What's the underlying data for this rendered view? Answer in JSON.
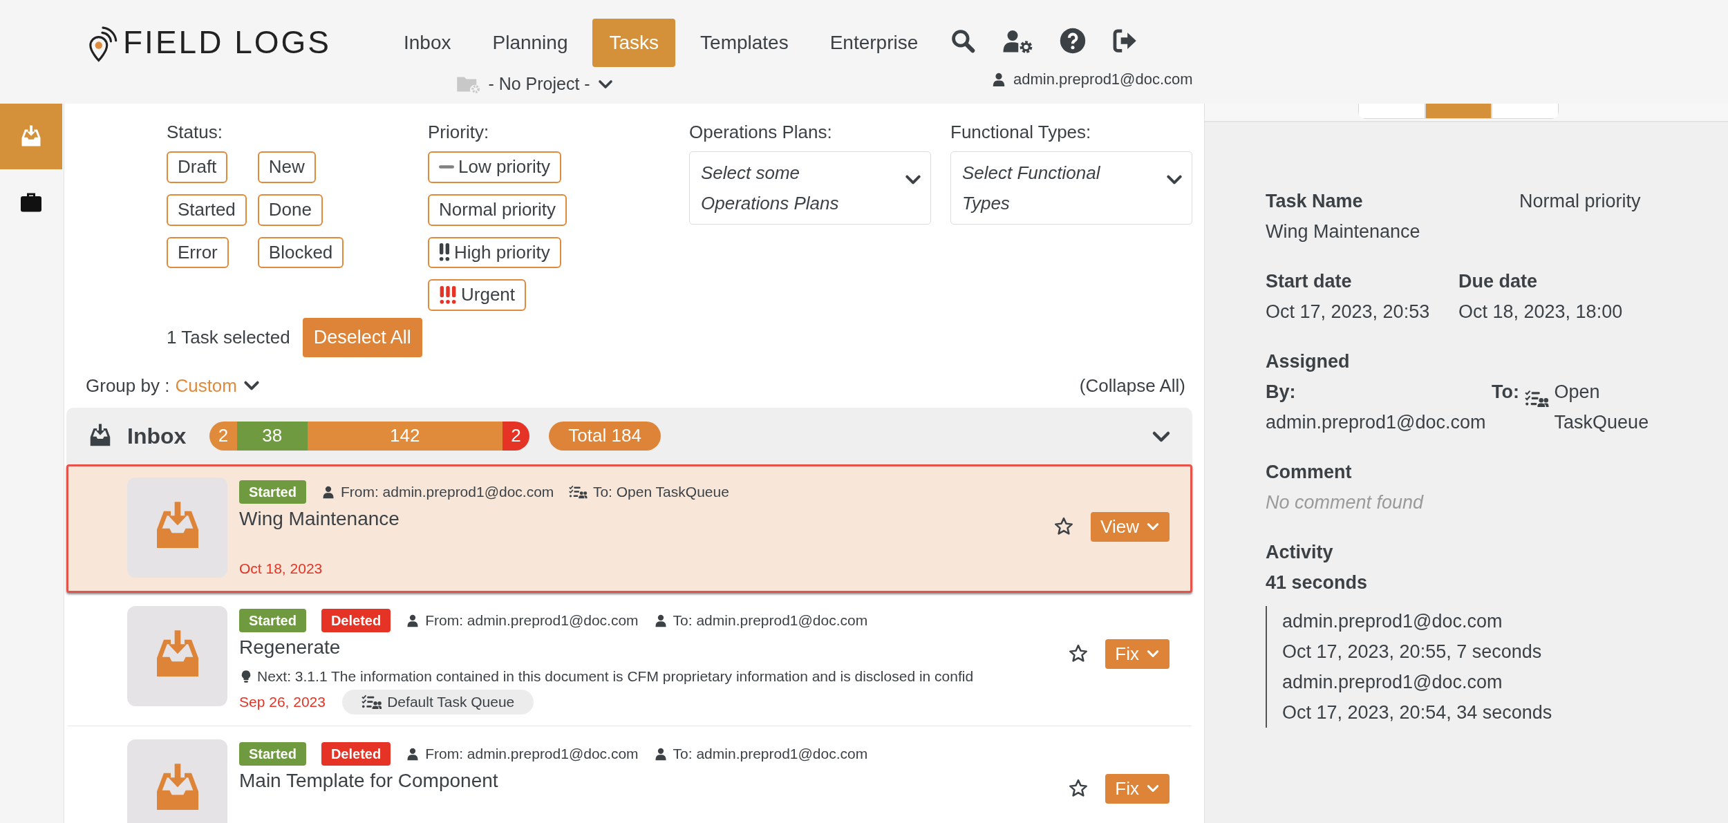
{
  "header": {
    "logo": "FIELD LOGS",
    "nav": [
      {
        "label": "Inbox",
        "selected": false
      },
      {
        "label": "Planning",
        "selected": false
      },
      {
        "label": "Tasks",
        "selected": true
      },
      {
        "label": "Templates",
        "selected": false
      },
      {
        "label": "Enterprise",
        "selected": false
      }
    ],
    "project": "- No Project -",
    "user": "admin.preprod1@doc.com"
  },
  "sidebar": {
    "items": [
      {
        "kind": "inbox",
        "selected": true
      },
      {
        "kind": "briefcase",
        "selected": false
      }
    ]
  },
  "filters": {
    "status": {
      "label": "Status:",
      "options": [
        "Draft",
        "New",
        "Started",
        "Done",
        "Error",
        "Blocked"
      ]
    },
    "priority": {
      "label": "Priority:",
      "options": [
        {
          "kind": "low",
          "label": "Low priority"
        },
        {
          "kind": "normal",
          "label": "Normal priority"
        },
        {
          "kind": "high",
          "label": "High priority"
        },
        {
          "kind": "urgent",
          "label": "Urgent"
        }
      ]
    },
    "operations_plans": {
      "label": "Operations Plans:",
      "placeholder": "Select some Operations Plans"
    },
    "functional_types": {
      "label": "Functional Types:",
      "placeholder": "Select Functional Types"
    }
  },
  "selection": {
    "text": "1 Task selected",
    "button": "Deselect All"
  },
  "group_by": {
    "label": "Group by :",
    "value": "Custom"
  },
  "collapse_all": "(Collapse All)",
  "group": {
    "title": "Inbox",
    "expanded": true,
    "total": "Total 184",
    "segments": [
      {
        "label": "2",
        "color": "#e08a3c"
      },
      {
        "label": "38",
        "color": "#6f9a3f"
      },
      {
        "label": "142",
        "color": "#e08a3c"
      },
      {
        "label": "2",
        "color": "#e53325"
      }
    ]
  },
  "tasks": [
    {
      "selected": true,
      "starred": false,
      "badges": [
        {
          "kind": "started",
          "label": "Started"
        }
      ],
      "from": "From: admin.preprod1@doc.com",
      "to": {
        "kind": "queue",
        "text": "To: Open TaskQueue"
      },
      "title": "Wing Maintenance",
      "date": "Oct 18, 2023",
      "action": "View"
    },
    {
      "selected": false,
      "starred": false,
      "badges": [
        {
          "kind": "started",
          "label": "Started"
        },
        {
          "kind": "deleted",
          "label": "Deleted"
        }
      ],
      "from": "From: admin.preprod1@doc.com",
      "to": {
        "kind": "user",
        "text": "To: admin.preprod1@doc.com"
      },
      "title": "Regenerate",
      "next": "Next: 3.1.1 The information contained in this document is CFM proprietary information and is disclosed in confid",
      "date": "Sep 26, 2023",
      "queue": "Default Task Queue",
      "action": "Fix"
    },
    {
      "selected": false,
      "starred": false,
      "badges": [
        {
          "kind": "started",
          "label": "Started"
        },
        {
          "kind": "deleted",
          "label": "Deleted"
        }
      ],
      "from": "From: admin.preprod1@doc.com",
      "to": {
        "kind": "user",
        "text": "To: admin.preprod1@doc.com"
      },
      "title": "Main Template for Component",
      "action": "Fix"
    }
  ],
  "detail": {
    "tabs": [
      {
        "selected": false
      },
      {
        "selected": true
      },
      {
        "selected": false
      }
    ],
    "task_name_label": "Task Name",
    "task_name": "Wing Maintenance",
    "priority": "Normal priority",
    "start_date_label": "Start date",
    "start_date": "Oct 17, 2023, 20:53",
    "due_date_label": "Due date",
    "due_date": "Oct 18, 2023, 18:00",
    "assigned_label": "Assigned",
    "by_label": "By:",
    "by": "admin.preprod1@doc.com",
    "to_label": "To:",
    "to": "Open TaskQueue",
    "comment_label": "Comment",
    "comment": "No comment found",
    "activity_label": "Activity",
    "activity_total": "41 seconds",
    "activity": [
      {
        "user": "admin.preprod1@doc.com",
        "time": "Oct 17, 2023, 20:55, 7 seconds"
      },
      {
        "user": "admin.preprod1@doc.com",
        "time": "Oct 17, 2023, 20:54, 34 seconds"
      }
    ]
  }
}
